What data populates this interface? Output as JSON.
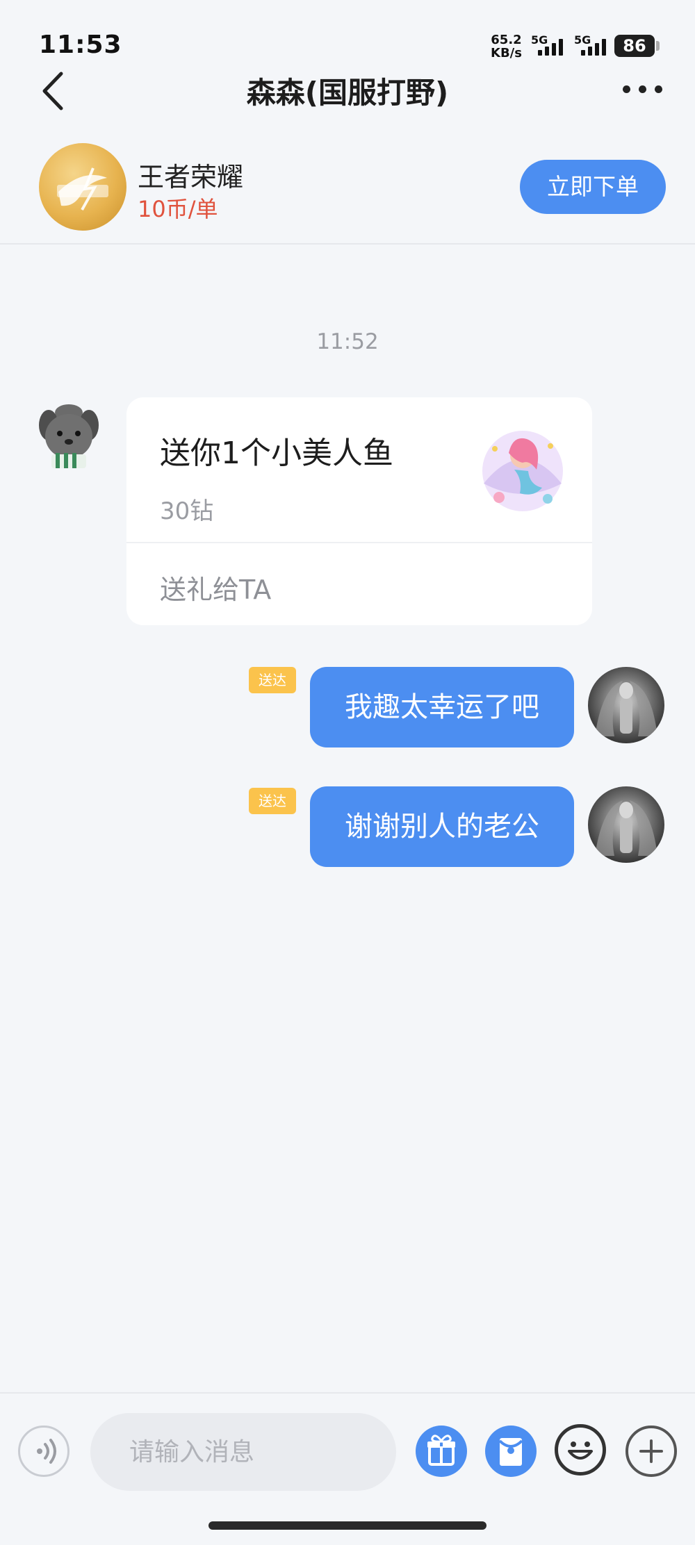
{
  "status_bar": {
    "time": "11:53",
    "net_speed_value": "65.2",
    "net_speed_unit": "KB/s",
    "sim1_label": "5G",
    "sim2_label": "5G",
    "battery": "86"
  },
  "header": {
    "title": "森森(国服打野)"
  },
  "service": {
    "game_name": "王者荣耀",
    "price": "10币/单",
    "order_button": "立即下单"
  },
  "chat": {
    "time": "11:52",
    "gift_message": {
      "title": "送你1个小美人鱼",
      "price": "30钻",
      "action": "送礼给TA"
    },
    "messages": [
      {
        "status": "送达",
        "text": "我趣太幸运了吧"
      },
      {
        "status": "送达",
        "text": "谢谢别人的老公"
      }
    ]
  },
  "input_bar": {
    "placeholder": "请输入消息"
  },
  "colors": {
    "accent": "#4c8ef1",
    "price": "#e0523d",
    "badge": "#fbc34c",
    "background": "#f4f6f9"
  }
}
